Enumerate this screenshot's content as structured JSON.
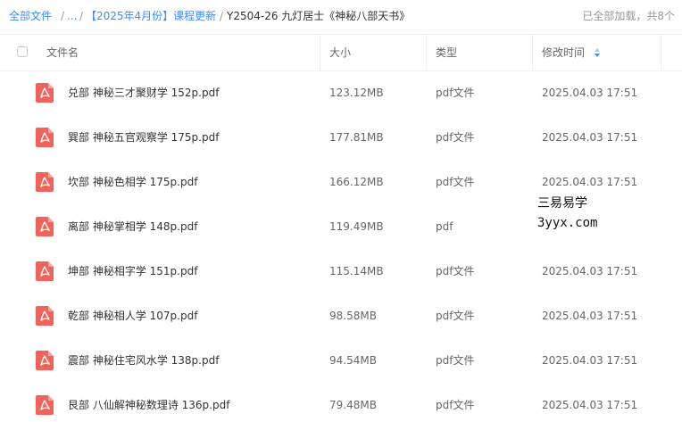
{
  "breadcrumb": {
    "root": "全部文件",
    "sep": "/",
    "ellipsis": "...",
    "parent": "【2025年4月份】课程更新",
    "current": "Y2504-26 九灯居士《神秘八部天书》"
  },
  "load_status": "已全部加载，共8个",
  "columns": {
    "name": "文件名",
    "size": "大小",
    "type": "类型",
    "modified": "修改时间"
  },
  "files": [
    {
      "name": "兑部 神秘三才聚财学 152p.pdf",
      "size": "123.12MB",
      "type": "pdf文件",
      "modified": "2025.04.03 17:51"
    },
    {
      "name": "巽部 神秘五官观察学 175p.pdf",
      "size": "177.81MB",
      "type": "pdf文件",
      "modified": "2025.04.03 17:51"
    },
    {
      "name": "坎部 神秘色相学 175p.pdf",
      "size": "166.12MB",
      "type": "pdf文件",
      "modified": "2025.04.03 17:51"
    },
    {
      "name": "离部 神秘掌相学 148p.pdf",
      "size": "119.49MB",
      "type": "pdf",
      "modified": ""
    },
    {
      "name": "坤部 神秘相字学 151p.pdf",
      "size": "115.14MB",
      "type": "pdf文件",
      "modified": "2025.04.03 17:51"
    },
    {
      "name": "乾部 神秘相人学 107p.pdf",
      "size": "98.58MB",
      "type": "pdf文件",
      "modified": "2025.04.03 17:51"
    },
    {
      "name": "震部 神秘住宅风水学 138p.pdf",
      "size": "94.54MB",
      "type": "pdf文件",
      "modified": "2025.04.03 17:51"
    },
    {
      "name": "艮部 八仙解神秘数理诗 136p.pdf",
      "size": "79.48MB",
      "type": "pdf文件",
      "modified": "2025.04.03 17:51"
    }
  ],
  "watermark": {
    "line1": "三易易学",
    "line2": "3yyx.com"
  },
  "colors": {
    "link": "#3b8cff",
    "pdf_icon": "#f0625a",
    "sort_active": "#3b8cff"
  },
  "icons": {
    "file": "pdf-file-icon",
    "sort": "sort-icon"
  }
}
